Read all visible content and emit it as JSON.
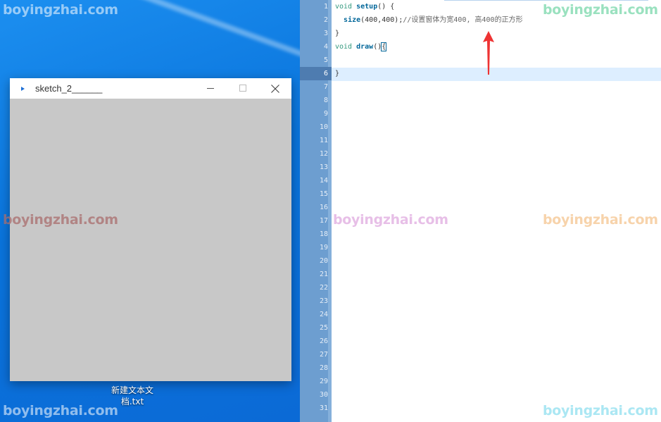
{
  "sketch_window": {
    "title": "sketch_2______"
  },
  "desktop": {
    "file_label_line1": "新建文本文",
    "file_label_line2": "档.txt"
  },
  "editor": {
    "line_numbers": [
      "1",
      "2",
      "3",
      "4",
      "5",
      "6",
      "7",
      "8",
      "9",
      "10",
      "11",
      "12",
      "13",
      "14",
      "15",
      "16",
      "17",
      "18",
      "19",
      "20",
      "21",
      "22",
      "23",
      "24",
      "25",
      "26",
      "27",
      "28",
      "29",
      "30",
      "31"
    ],
    "active_line": 6,
    "code": {
      "l1_kw": "void",
      "l1_fn": "setup",
      "l1_rest": "() {",
      "l2_fn": "size",
      "l2_args": "(400,400);",
      "l2_comment": "//设置窗体为宽400, 高400的正方形",
      "l3": "}",
      "l4_kw": "void",
      "l4_fn": "draw",
      "l4_parens": "()",
      "l4_brace": "{",
      "l5": "",
      "l6": "}"
    }
  },
  "watermarks": {
    "text": "boyingzhai.com"
  },
  "colors": {
    "desktop_blue": "#1a7fe0",
    "gutter": "#6d9ed0",
    "active_line": "#ddeeff",
    "arrow": "#ee3333",
    "sketch_canvas": "#c8c8c8"
  }
}
